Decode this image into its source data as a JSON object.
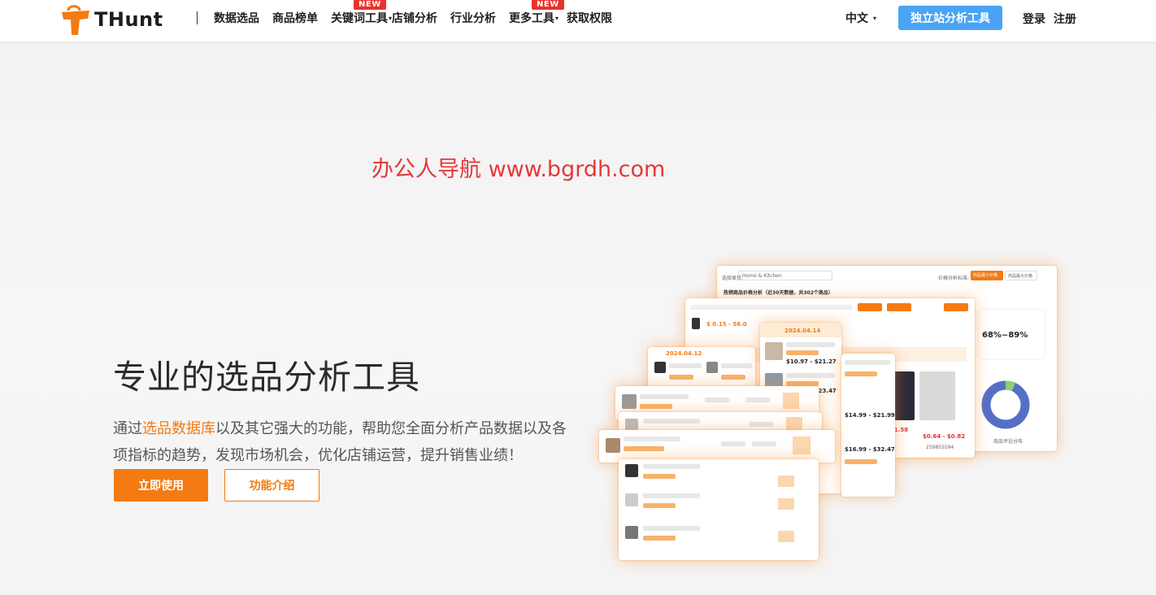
{
  "nav": {
    "brand": "THunt",
    "links": [
      {
        "label": "数据选品",
        "new": false,
        "caret": false
      },
      {
        "label": "商品榜单",
        "new": false,
        "caret": false
      },
      {
        "label": "关键词工具",
        "new": true,
        "caret": true
      },
      {
        "label": "店铺分析",
        "new": false,
        "caret": false
      },
      {
        "label": "行业分析",
        "new": false,
        "caret": false
      },
      {
        "label": "更多工具",
        "new": true,
        "caret": true
      },
      {
        "label": "获取权限",
        "new": false,
        "caret": false
      }
    ],
    "new_badge": "NEW",
    "language": "中文",
    "tool_button": "独立站分析工具",
    "login": "登录",
    "register": "注册"
  },
  "watermark": "办公人导航 www.bgrdh.com",
  "hero": {
    "title": "专业的选品分析工具",
    "desc_prefix": "通过",
    "desc_highlight": "选品数据库",
    "desc_suffix": "以及其它强大的功能，帮助您全面分析产品数据以及各项指标的趋势，发现市场机会，优化店铺运营，提升销售业绩！",
    "primary_button": "立即使用",
    "secondary_button": "功能介绍"
  },
  "illustration": {
    "category_label": "选择类目:",
    "category_value": "Home & Kitchen",
    "price_std_label": "价格分析标准:",
    "price_std_a": "商品最小价格",
    "price_std_b": "商品最大价格",
    "analysis_title": "热销商品价格分析（近30天数据，共302个商品）",
    "price_range": "$ 0.15 - 56.0",
    "percent_range": "68%~89%",
    "date_a": "2024.04.14",
    "date_b": "2024.04.12",
    "price_a": "$10.97 - $21.27",
    "price_b": "$19.18 - $23.47",
    "price_c": "$0.64 - $0.82",
    "price_d": "$1.58",
    "price_e": "$14.99 - $21.99",
    "price_f": "$16.99 - $32.47",
    "store_id": "259855594",
    "chart_caption": "商品评论分布",
    "colors": {
      "accent": "#f47a12",
      "blue": "#4aa3f5",
      "red": "#e8322b",
      "donut": "#5470c6"
    }
  }
}
